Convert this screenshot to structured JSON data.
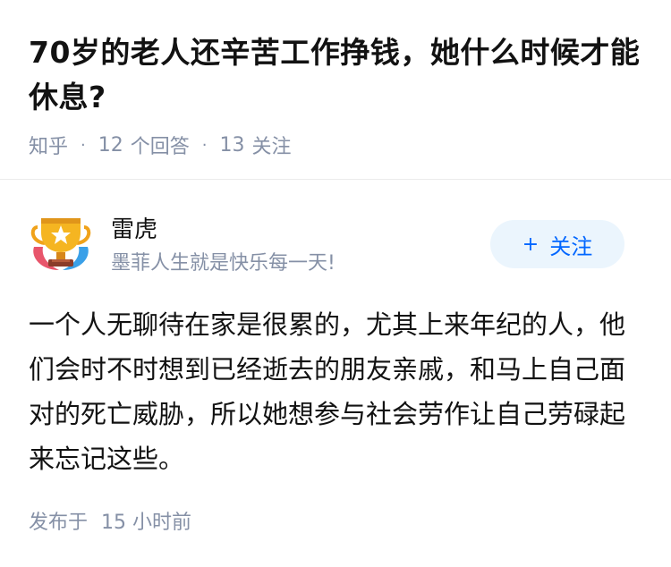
{
  "question": {
    "title": "70岁的老人还辛苦工作挣钱，她什么时候才能休息?",
    "source": "知乎",
    "answer_count": "12",
    "answer_label": "个回答",
    "follow_count": "13",
    "follow_label": "关注"
  },
  "author": {
    "name": "雷虎",
    "bio": "墨菲人生就是快乐每一天!",
    "avatar_icon": "trophy-badge-icon",
    "follow_button": {
      "plus": "+",
      "label": "关注"
    }
  },
  "answer": {
    "content": "一个人无聊待在家是很累的，尤其上来年纪的人，他们会时不时想到已经逝去的朋友亲戚，和马上自己面对的死亡威胁，所以她想参与社会劳作让自己劳碌起来忘记这些。",
    "published_label": "发布于",
    "published_time": "15 小时前"
  },
  "colors": {
    "accent": "#0066ff",
    "follow_bg": "#ebf5fd",
    "meta_gray": "#8590a6"
  }
}
